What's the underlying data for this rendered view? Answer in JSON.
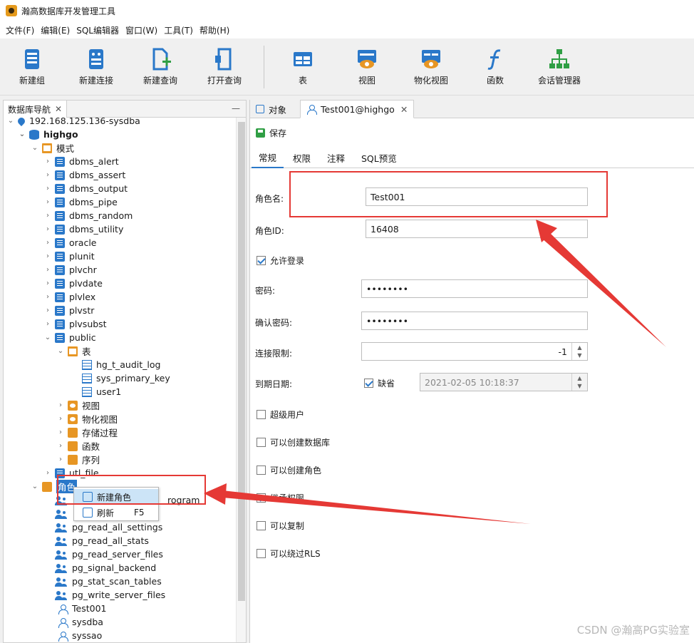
{
  "app": {
    "title": "瀚高数据库开发管理工具"
  },
  "menu": [
    "文件(F)",
    "编辑(E)",
    "SQL编辑器",
    "窗口(W)",
    "工具(T)",
    "帮助(H)"
  ],
  "toolbar": [
    {
      "label": "新建组",
      "icon": "group-icon"
    },
    {
      "label": "新建连接",
      "icon": "connection-icon"
    },
    {
      "label": "新建查询",
      "icon": "new-query-icon"
    },
    {
      "label": "打开查询",
      "icon": "open-query-icon"
    },
    {
      "label": "表",
      "icon": "table-icon"
    },
    {
      "label": "视图",
      "icon": "view-icon"
    },
    {
      "label": "物化视图",
      "icon": "materialized-view-icon"
    },
    {
      "label": "函数",
      "icon": "function-icon"
    },
    {
      "label": "会话管理器",
      "icon": "session-manager-icon"
    }
  ],
  "nav": {
    "tab": "数据库导航",
    "tree": [
      {
        "label": "192.168.125.136-sysdba",
        "icon": "server"
      },
      {
        "label": "highgo",
        "icon": "db"
      },
      {
        "label": "模式",
        "icon": "folder-tbl"
      },
      {
        "label": "dbms_alert",
        "icon": "proc"
      },
      {
        "label": "dbms_assert",
        "icon": "proc"
      },
      {
        "label": "dbms_output",
        "icon": "proc"
      },
      {
        "label": "dbms_pipe",
        "icon": "proc"
      },
      {
        "label": "dbms_random",
        "icon": "proc"
      },
      {
        "label": "dbms_utility",
        "icon": "proc"
      },
      {
        "label": "oracle",
        "icon": "proc"
      },
      {
        "label": "plunit",
        "icon": "proc"
      },
      {
        "label": "plvchr",
        "icon": "proc"
      },
      {
        "label": "plvdate",
        "icon": "proc"
      },
      {
        "label": "plvlex",
        "icon": "proc"
      },
      {
        "label": "plvstr",
        "icon": "proc"
      },
      {
        "label": "plvsubst",
        "icon": "proc"
      },
      {
        "label": "public",
        "icon": "proc"
      },
      {
        "label": "表",
        "icon": "folder-tbl"
      },
      {
        "label": "hg_t_audit_log",
        "icon": "table"
      },
      {
        "label": "sys_primary_key",
        "icon": "table"
      },
      {
        "label": "user1",
        "icon": "table"
      },
      {
        "label": "视图",
        "icon": "eye"
      },
      {
        "label": "物化视图",
        "icon": "eye"
      },
      {
        "label": "存储过程",
        "icon": "folder"
      },
      {
        "label": "函数",
        "icon": "folder"
      },
      {
        "label": "序列",
        "icon": "folder"
      },
      {
        "label": "utl_file",
        "icon": "proc"
      },
      {
        "label": "角色",
        "icon": "folder"
      },
      {
        "label": "rogram",
        "icon": "users"
      },
      {
        "label": "",
        "icon": "users"
      },
      {
        "label": "pg_read_all_settings",
        "icon": "users"
      },
      {
        "label": "pg_read_all_stats",
        "icon": "users"
      },
      {
        "label": "pg_read_server_files",
        "icon": "users"
      },
      {
        "label": "pg_signal_backend",
        "icon": "users"
      },
      {
        "label": "pg_stat_scan_tables",
        "icon": "users"
      },
      {
        "label": "pg_write_server_files",
        "icon": "users"
      },
      {
        "label": "Test001",
        "icon": "user"
      },
      {
        "label": "sysdba",
        "icon": "user"
      },
      {
        "label": "syssao",
        "icon": "user"
      }
    ]
  },
  "context_menu": [
    {
      "label": "新建角色",
      "shortcut": ""
    },
    {
      "label": "刷新",
      "shortcut": "F5"
    }
  ],
  "editor": {
    "tabs": [
      {
        "label": "对象"
      },
      {
        "label": "Test001@highgo"
      }
    ],
    "save_label": "保存",
    "subtabs": [
      "常规",
      "权限",
      "注释",
      "SQL预览"
    ],
    "form": {
      "role_name_label": "角色名:",
      "role_name_value": "Test001",
      "role_id_label": "角色ID:",
      "role_id_value": "16408",
      "allow_login_label": "允许登录",
      "password_label": "密码:",
      "password_value": "••••••••",
      "confirm_password_label": "确认密码:",
      "confirm_password_value": "••••••••",
      "conn_limit_label": "连接限制:",
      "conn_limit_value": "-1",
      "expiry_label": "到期日期:",
      "default_label": "缺省",
      "expiry_value": "2021-02-05 10:18:37",
      "superuser_label": "超级用户",
      "create_db_label": "可以创建数据库",
      "create_role_label": "可以创建角色",
      "inherit_label": "继承权限",
      "replication_label": "可以复制",
      "bypass_rls_label": "可以绕过RLS"
    },
    "checkbox_states": {
      "allow_login": true,
      "default": true,
      "superuser": false,
      "create_db": false,
      "create_role": false,
      "inherit": true,
      "replication": false,
      "bypass_rls": false
    }
  },
  "watermark": "CSDN @瀚高PG实验室",
  "colors": {
    "accent": "#2a78c9",
    "annotation_red": "#e53935",
    "folder_orange": "#e79624"
  }
}
